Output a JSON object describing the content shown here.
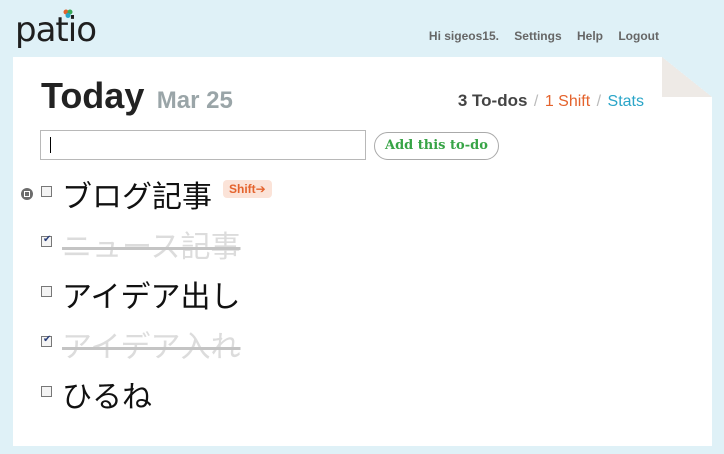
{
  "brand": {
    "name": "patio",
    "leaf_color": "#3aa859"
  },
  "topnav": {
    "greeting": "Hi sigeos15.",
    "settings": "Settings",
    "help": "Help",
    "logout": "Logout"
  },
  "header": {
    "title": "Today",
    "date": "Mar 25",
    "todo_count": "3 To-dos",
    "shift_link": "1 Shift",
    "stats_link": "Stats"
  },
  "entry": {
    "value": "",
    "add_button": "Add this to-do"
  },
  "todos": [
    {
      "text": "ブログ記事",
      "done": false,
      "badge": "Shift➔"
    },
    {
      "text": "ニュース記事",
      "done": true
    },
    {
      "text": "アイデア出し",
      "done": false
    },
    {
      "text": "アイデア入れ",
      "done": true
    },
    {
      "text": "ひるね",
      "done": false
    }
  ],
  "colors": {
    "accent_shift": "#e4632d",
    "accent_stats": "#2aa5c8",
    "add_button_text": "#37a446",
    "background": "#dff1f7"
  }
}
